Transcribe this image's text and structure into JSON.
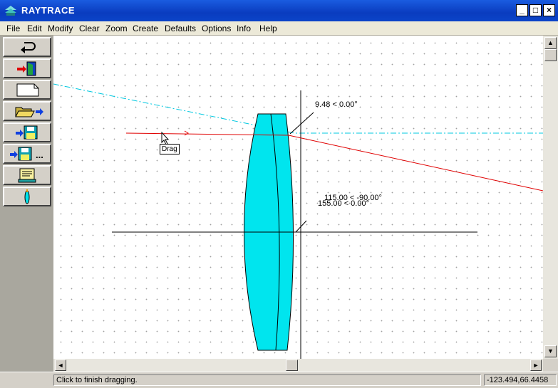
{
  "window": {
    "title": "RAYTRACE",
    "minimize_glyph": "_",
    "maximize_glyph": "□",
    "close_glyph": "×"
  },
  "menu": [
    "File",
    "Edit",
    "Modify",
    "Clear",
    "Zoom",
    "Create",
    "Defaults",
    "Options",
    "Info",
    "Help"
  ],
  "toolbar": [
    {
      "name": "undo-button",
      "icon": "undo-arrow-icon"
    },
    {
      "name": "exit-button",
      "icon": "exit-door-icon"
    },
    {
      "name": "new-button",
      "icon": "blank-page-icon"
    },
    {
      "name": "open-button",
      "icon": "open-folder-icon"
    },
    {
      "name": "save-button",
      "icon": "floppy-save-icon"
    },
    {
      "name": "save-as-button",
      "icon": "floppy-save-as-icon"
    },
    {
      "name": "print-button",
      "icon": "print-scroll-icon"
    },
    {
      "name": "lens-button",
      "icon": "lens-icon"
    }
  ],
  "save_as_suffix": "...",
  "canvas": {
    "drag_tooltip": "Drag",
    "labels": {
      "top": "9.48 <  0.00°",
      "mid1": "115.00 < -90.00°",
      "mid2": "155.00 <  0.00°"
    }
  },
  "scrollbar": {
    "up": "▲",
    "down": "▼",
    "left": "◄",
    "right": "►"
  },
  "status": {
    "message": "Click to finish dragging.",
    "coords": "-123.494,66.4458"
  },
  "colors": {
    "lens": "#00e5ee",
    "ray": "#e00000",
    "axis_dashdot": "#00c8e0",
    "title_bar": "#0a3cbf"
  }
}
